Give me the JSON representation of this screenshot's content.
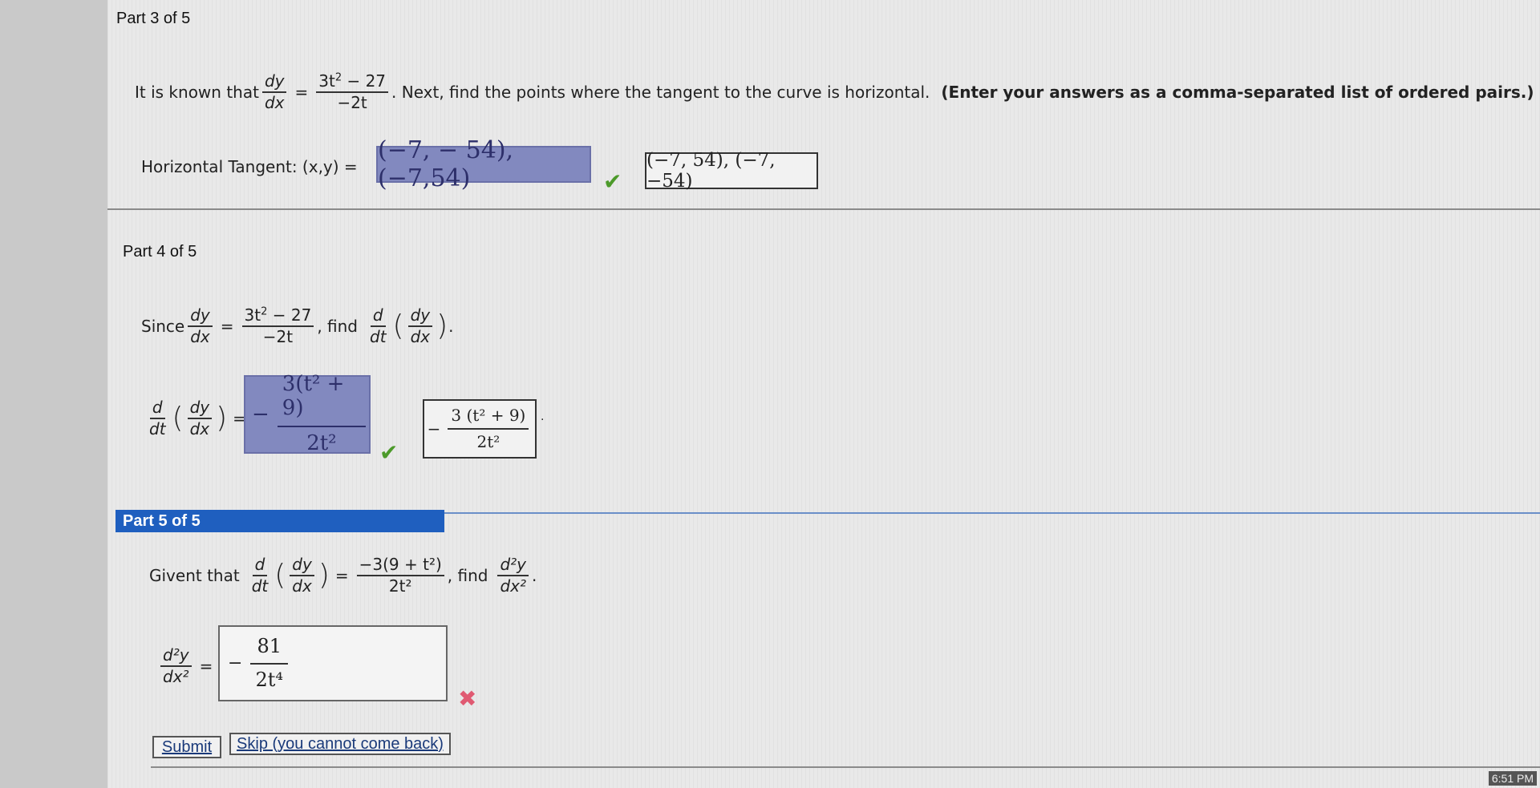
{
  "part3": {
    "label": "Part 3 of 5",
    "intro": "It is known that",
    "dy": "dy",
    "dx": "dx",
    "eq": "=",
    "num_3t": "3t",
    "num_exp": "2",
    "num_rest": " − 27",
    "den": "−2t",
    "next": ". Next, find the points where the tangent to the curve is horizontal.",
    "instruction": "(Enter your answers as a comma-separated list of ordered pairs.)",
    "field_label": "Horizontal Tangent: (x,y) =",
    "answer": "(−7, − 54),(−7,54)",
    "correct_answer": "(−7, 54), (−7, −54)"
  },
  "part4": {
    "label": "Part 4 of 5",
    "since": "Since",
    "find": ", find",
    "d": "d",
    "dt": "dt",
    "dy": "dy",
    "dx": "dx",
    "num_3t": "3t",
    "num_exp": "2",
    "num_rest": " − 27",
    "den": "−2t",
    "period": ".",
    "eq": "=",
    "answer_sign": "−",
    "answer_num": "3(t² + 9)",
    "answer_den": "2t²",
    "correct_sign": "−",
    "correct_num": "3 (t² + 9)",
    "correct_den": "2t²",
    "trailing_dot": "."
  },
  "part5": {
    "label": "Part 5 of 5",
    "given": "Givent that",
    "d": "d",
    "dt": "dt",
    "dy": "dy",
    "dx": "dx",
    "eq": "=",
    "num": "−3(9 + t²)",
    "den": "2t²",
    "find": ", find",
    "d2y": "d²y",
    "dx2": "dx²",
    "period": ".",
    "answer_sign": "−",
    "answer_num": "81",
    "answer_den": "2t⁴",
    "submit": "Submit",
    "skip": "Skip (you cannot come back)"
  },
  "clock": "6:51 PM",
  "colors": {
    "header_blue": "#1f5fbf",
    "input_fill": "#8289bf",
    "check": "#4c9a2a",
    "cross": "#e05a72"
  }
}
